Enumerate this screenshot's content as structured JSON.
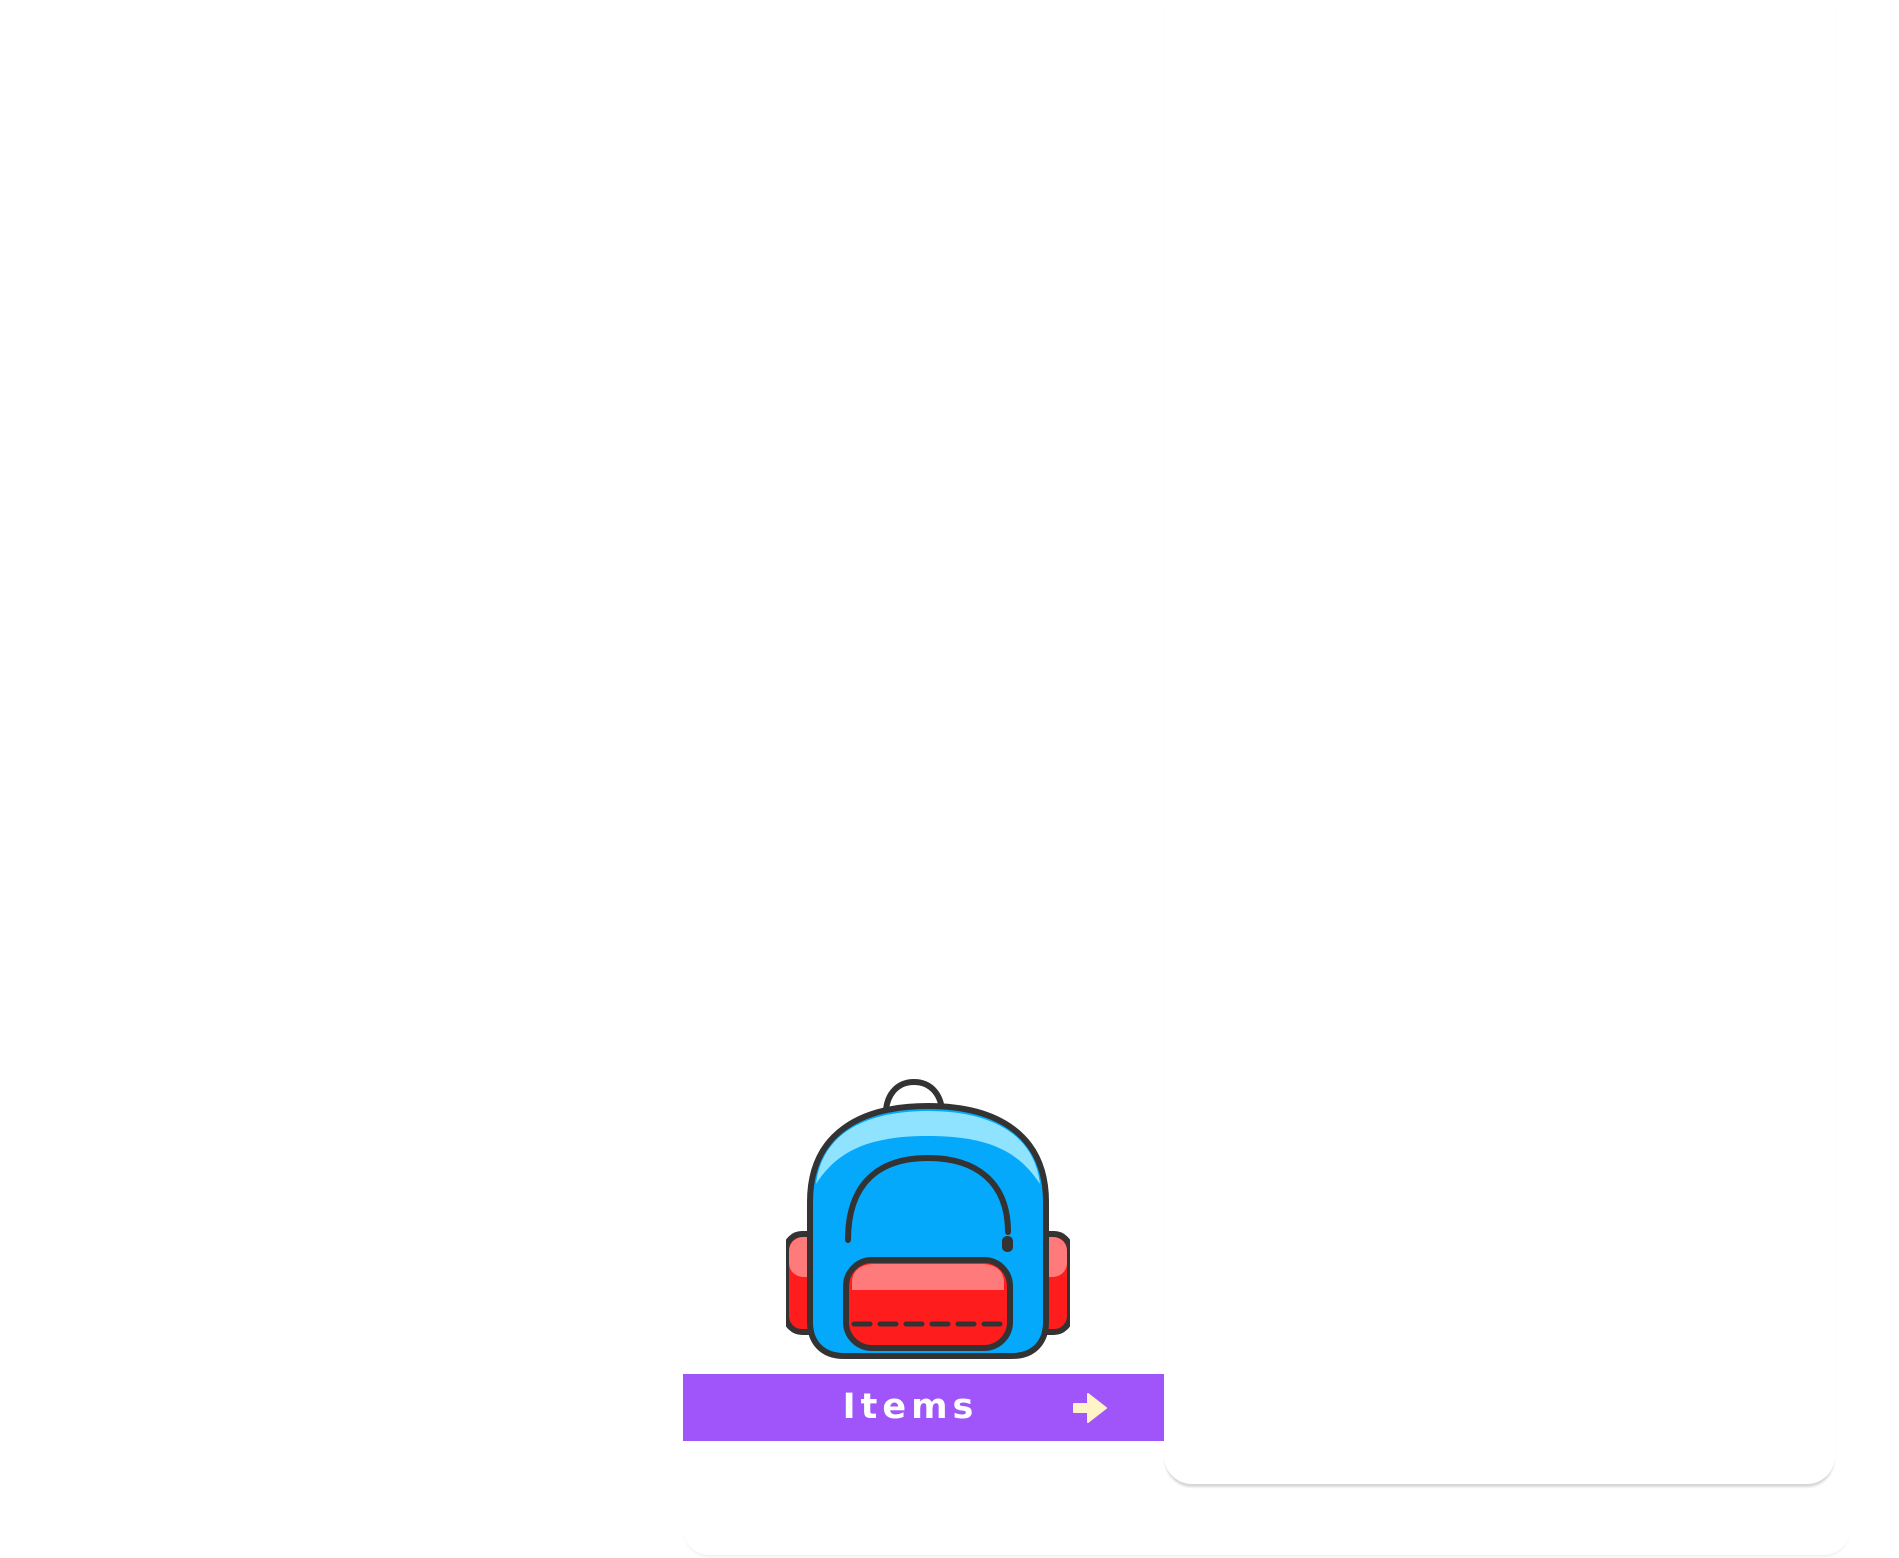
{
  "tile": {
    "label": "Items",
    "icon": "backpack-icon",
    "action_icon": "arrow-right-icon"
  },
  "colors": {
    "bar": "#a055fa",
    "label_text": "#ffffff",
    "arrow": "#fff4c8",
    "backpack_body": "#04a9fb",
    "backpack_top_highlight": "#8fe3ff",
    "backpack_pocket": "#ff1c1c",
    "backpack_pocket_highlight": "#ff7a7a",
    "outline": "#333333"
  }
}
